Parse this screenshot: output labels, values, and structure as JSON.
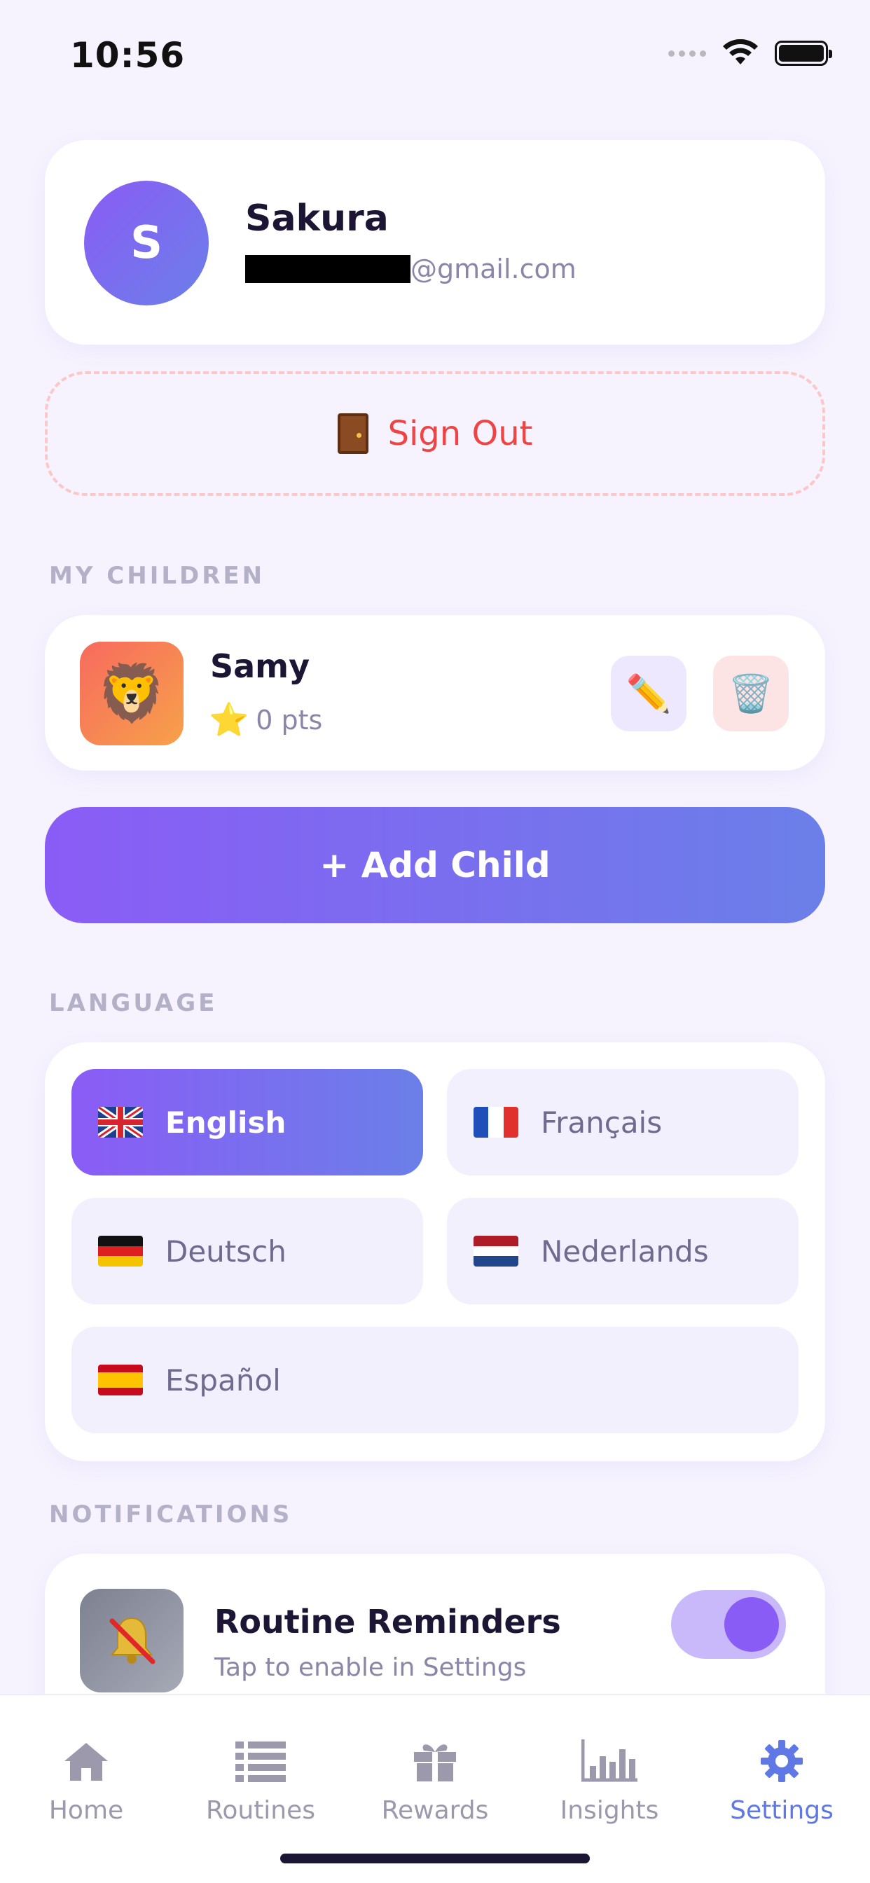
{
  "status_bar": {
    "time": "10:56"
  },
  "profile": {
    "avatar_initial": "S",
    "name": "Sakura",
    "email_visible": "@gmail.com"
  },
  "sign_out": {
    "label": "Sign Out",
    "icon": "door-icon"
  },
  "children_section": {
    "title": "MY CHILDREN",
    "children": [
      {
        "name": "Samy",
        "avatar_emoji": "🦁",
        "points": "0 pts",
        "star_icon": "⭐",
        "edit_icon": "✏️",
        "delete_icon": "🗑️"
      }
    ],
    "add_child_label": "+ Add Child"
  },
  "language_section": {
    "title": "LANGUAGE",
    "options": [
      {
        "label": "English",
        "flag": "uk-flag",
        "selected": true
      },
      {
        "label": "Français",
        "flag": "fr-flag",
        "selected": false
      },
      {
        "label": "Deutsch",
        "flag": "de-flag",
        "selected": false
      },
      {
        "label": "Nederlands",
        "flag": "nl-flag",
        "selected": false
      },
      {
        "label": "Español",
        "flag": "es-flag",
        "selected": false
      }
    ]
  },
  "notifications_section": {
    "title": "NOTIFICATIONS",
    "items": [
      {
        "title": "Routine Reminders",
        "subtitle": "Tap to enable in Settings",
        "enabled": true,
        "icon": "bell-muted-icon"
      }
    ]
  },
  "tab_bar": {
    "tabs": [
      {
        "label": "Home",
        "icon": "home-icon",
        "active": false
      },
      {
        "label": "Routines",
        "icon": "list-icon",
        "active": false
      },
      {
        "label": "Rewards",
        "icon": "gift-icon",
        "active": false
      },
      {
        "label": "Insights",
        "icon": "chart-icon",
        "active": false
      },
      {
        "label": "Settings",
        "icon": "gear-icon",
        "active": true
      }
    ]
  },
  "colors": {
    "background": "#f6f3fe",
    "accent_start": "#8a5cf6",
    "accent_end": "#6b7fe8",
    "danger": "#ef4444",
    "tab_active": "#6078e6",
    "tab_inactive": "#9c99ad"
  }
}
